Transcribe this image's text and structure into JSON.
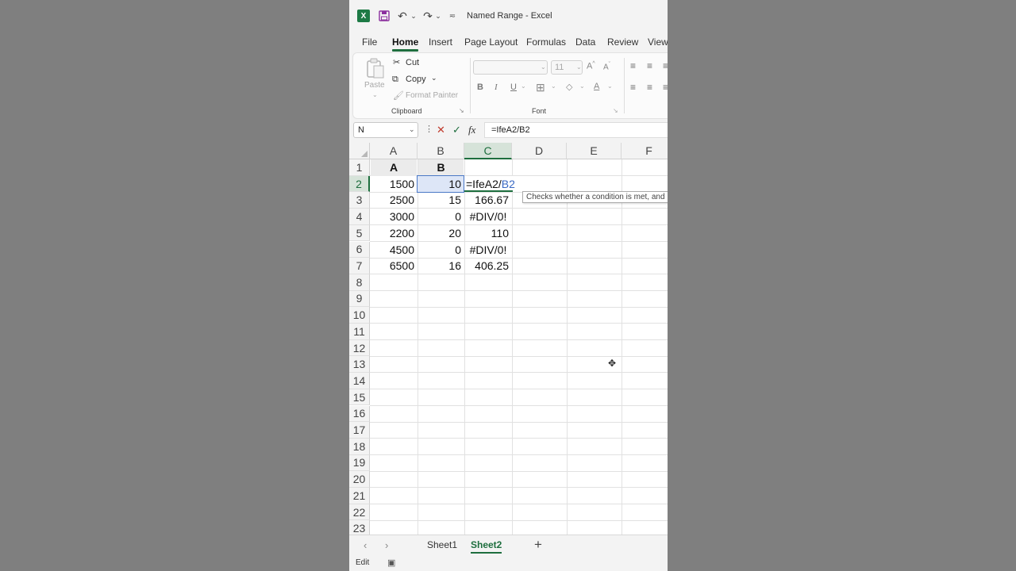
{
  "window": {
    "title": "Named Range - Excel",
    "app_logo": "X",
    "qat_icons": [
      "save-icon",
      "undo-icon",
      "redo-icon",
      "customize-qat-icon"
    ]
  },
  "ribbon_tabs": [
    "File",
    "Home",
    "Insert",
    "Page Layout",
    "Formulas",
    "Data",
    "Review",
    "View"
  ],
  "active_tab": "Home",
  "clipboard": {
    "paste": "Paste",
    "cut": "Cut",
    "copy": "Copy",
    "format_painter": "Format Painter",
    "group_label": "Clipboard"
  },
  "font": {
    "size": "11",
    "bold": "B",
    "italic": "I",
    "underline": "U",
    "font_color_glyph": "A",
    "group_label": "Font"
  },
  "formula_bar": {
    "name_box": "N",
    "cancel": "✕",
    "enter": "✓",
    "fx": "fx",
    "formula": "=IfeA2/B2"
  },
  "columns": [
    "A",
    "B",
    "C",
    "D",
    "E",
    "F"
  ],
  "selected_column": "C",
  "rows": [
    "1",
    "2",
    "3",
    "4",
    "5",
    "6",
    "7",
    "8",
    "9",
    "10",
    "11",
    "12",
    "13",
    "14",
    "15",
    "16",
    "17",
    "18",
    "19",
    "20",
    "21",
    "22",
    "23"
  ],
  "selected_row": "2",
  "cells": {
    "A1": "A",
    "B1": "B",
    "A2": "1500",
    "B2": "10",
    "A3": "2500",
    "B3": "15",
    "C3": "166.67",
    "A4": "3000",
    "B4": "0",
    "C4": "#DIV/0!",
    "A5": "2200",
    "B5": "20",
    "C5": "110",
    "A6": "4500",
    "B6": "0",
    "C6": "#DIV/0!",
    "A7": "6500",
    "B7": "16",
    "C7": "406.25"
  },
  "editing_cell": {
    "prefix": "=IfeA2/",
    "ref": "B2"
  },
  "tooltip": "Checks whether a condition is met, and r",
  "sheets": [
    "Sheet1",
    "Sheet2"
  ],
  "active_sheet": "Sheet2",
  "add_sheet": "+",
  "status": {
    "mode": "Edit"
  },
  "colors": {
    "accent": "#1e6e3e",
    "reference_blue": "#3a69c4",
    "selection_fill": "#dde6f7"
  }
}
